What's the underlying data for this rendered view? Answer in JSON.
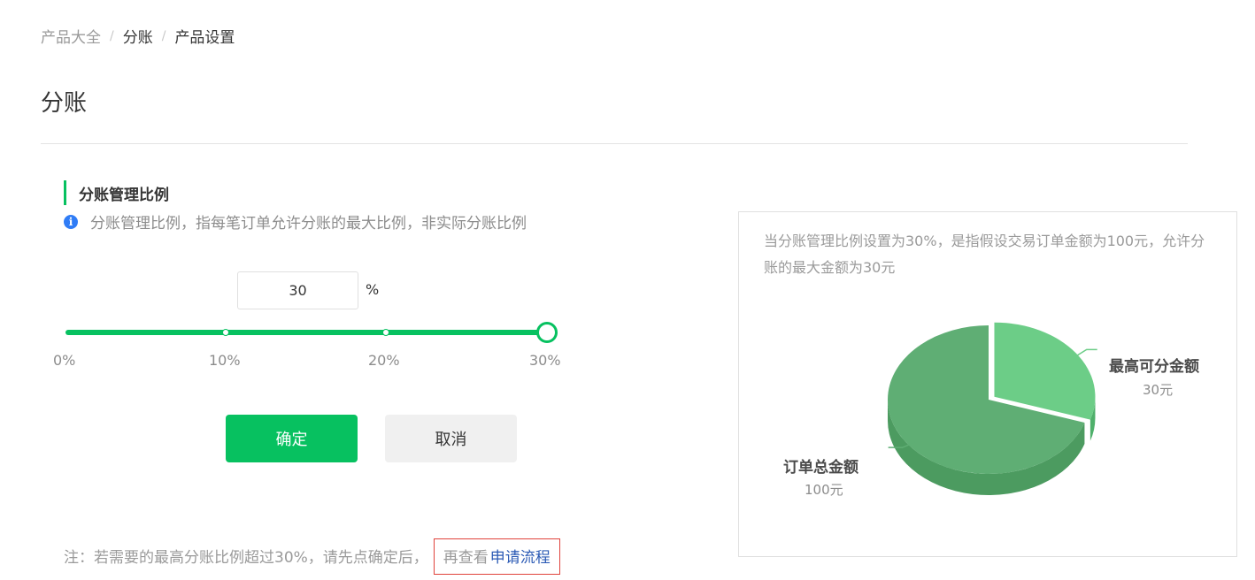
{
  "breadcrumb": {
    "items": [
      "产品大全",
      "分账",
      "产品设置"
    ],
    "separator": "/"
  },
  "page": {
    "title": "分账"
  },
  "section": {
    "title": "分账管理比例",
    "info": "分账管理比例，指每笔订单允许分账的最大比例，非实际分账比例"
  },
  "ratio": {
    "value": "30",
    "unit": "%",
    "slider_value_percent": 30,
    "slider_max_percent": 30,
    "slider_labels": [
      "0%",
      "10%",
      "20%",
      "30%"
    ]
  },
  "buttons": {
    "confirm": "确定",
    "cancel": "取消"
  },
  "note": {
    "prefix": "注：若需要的最高分账比例超过30%，请先点确定后，",
    "box_text": "再查看",
    "link": "申请流程"
  },
  "example": {
    "description": "当分账管理比例设置为30%，是指假设交易订单金额为100元，允许分账的最大金额为30元",
    "chart_data": {
      "type": "pie",
      "categories": [
        "最高可分金额",
        "订单总金额"
      ],
      "values": [
        30,
        100
      ],
      "value_labels": [
        "30元",
        "100元"
      ],
      "slice_fraction": 0.3,
      "colors": {
        "slice": "#6ccd87",
        "slice_side": "#4fb06b",
        "base": "#5fae74",
        "base_side": "#4c9b60"
      }
    }
  },
  "colors": {
    "accent": "#07c160",
    "info": "#2f7cf6",
    "link": "#2c5bb5",
    "highlight_border": "#e0433c"
  }
}
